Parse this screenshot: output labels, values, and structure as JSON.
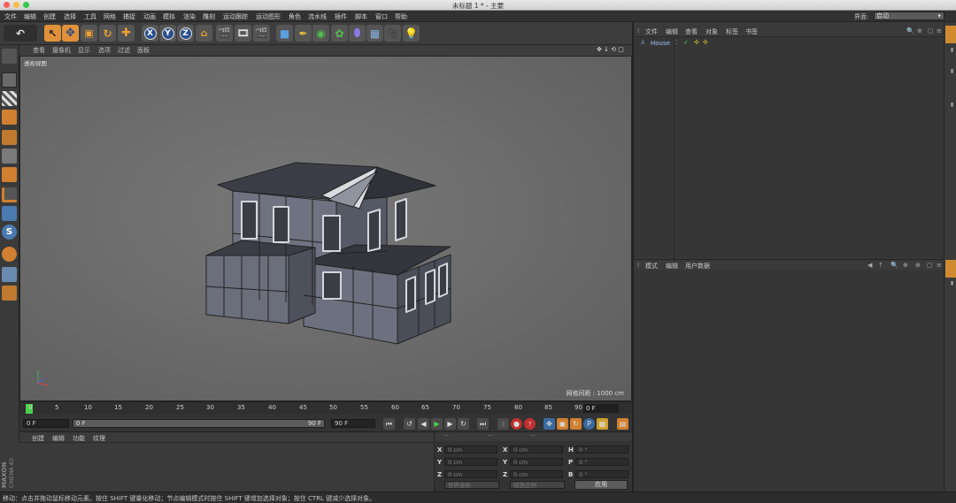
{
  "window": {
    "title": "未标题 1 * - 主要"
  },
  "menubar": {
    "items": [
      "文件",
      "编辑",
      "创建",
      "选择",
      "工具",
      "网格",
      "捕捉",
      "动画",
      "模拟",
      "渲染",
      "雕刻",
      "运动跟踪",
      "运动图形",
      "角色",
      "流水线",
      "插件",
      "脚本",
      "窗口",
      "帮助"
    ],
    "layout_label": "界面:",
    "layout_value": "启动"
  },
  "toolbar": {
    "axis_x": "X",
    "axis_y": "Y",
    "axis_z": "Z"
  },
  "viewport": {
    "menu": [
      "查看",
      "摄像机",
      "显示",
      "选项",
      "过滤",
      "面板"
    ],
    "label": "透视视图",
    "grid_info": "网格间距 : 1000 cm"
  },
  "timeline": {
    "ticks": [
      "0",
      "5",
      "10",
      "15",
      "20",
      "25",
      "30",
      "35",
      "40",
      "45",
      "50",
      "55",
      "60",
      "65",
      "70",
      "75",
      "80",
      "85",
      "90"
    ],
    "current_frame": "0 F"
  },
  "transport": {
    "start": "0 F",
    "preview_min": "0 F",
    "preview_max": "90 F",
    "end": "90 F"
  },
  "materials": {
    "menu": [
      "创建",
      "编辑",
      "功能",
      "纹理"
    ]
  },
  "coords": {
    "rows": [
      {
        "a": "X",
        "av": "0 cm",
        "b": "X",
        "bv": "0 cm",
        "c": "H",
        "cv": "0 °"
      },
      {
        "a": "Y",
        "av": "0 cm",
        "b": "Y",
        "bv": "0 cm",
        "c": "P",
        "cv": "0 °"
      },
      {
        "a": "Z",
        "av": "0 cm",
        "b": "Z",
        "bv": "0 cm",
        "c": "B",
        "cv": "0 °"
      }
    ],
    "mode1": "世界坐标",
    "mode2": "缩放比例",
    "apply": "应用"
  },
  "objects": {
    "menu": [
      "文件",
      "编辑",
      "查看",
      "对象",
      "标签",
      "书签"
    ],
    "items": [
      {
        "name": "House"
      }
    ]
  },
  "attributes": {
    "menu": [
      "模式",
      "编辑",
      "用户数据"
    ]
  },
  "status": {
    "text": "移动：点击并拖动鼠标移动元素。按住 SHIFT 键量化移动；节点编辑模式时按住 SHIFT 键增加选择对象；按住 CTRL 键减少选择对象。"
  },
  "brand": {
    "maxon": "MAXON",
    "product": "CINEMA 4D"
  }
}
